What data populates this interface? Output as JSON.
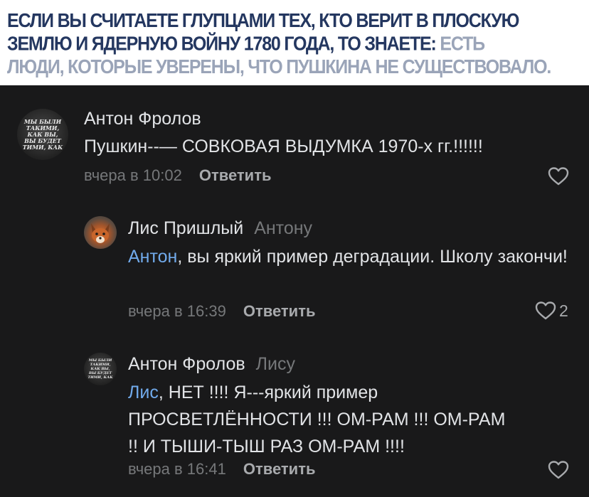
{
  "header": {
    "line1": "ЕСЛИ ВЫ СЧИТАЕТЕ ГЛУПЦАМИ ТЕХ, КТО ВЕРИТ В ПЛОСКУЮ",
    "line2_dark": "ЗЕМЛЮ И ЯДЕРНУЮ ВОЙНУ 1780 ГОДА, ТО ЗНАЕТЕ: ",
    "line2_muted": "ЕСТЬ",
    "line3": "ЛЮДИ, КОТОРЫЕ УВЕРЕНЫ, ЧТО ПУШКИНА НЕ СУЩЕСТВОВАЛО."
  },
  "avatar_caption": "МЫ БЫЛИ ТАКИМИ, КАК ВЫ, ВЫ БУДЕТ ТИМИ, КАК",
  "comments": [
    {
      "author": "Антон Фролов",
      "text": "Пушкин--— СОВКОВАЯ ВЫДУМКА 1970-х гг.!!!!!!",
      "time": "вчера в 10:02",
      "reply_label": "Ответить",
      "likes": ""
    },
    {
      "author": "Лис Пришлый",
      "reply_to": "Антону",
      "mention": "Антон",
      "text": ", вы яркий пример деградации. Школу закончи!",
      "time": "вчера в 16:39",
      "reply_label": "Ответить",
      "likes": "2"
    },
    {
      "author": "Антон Фролов",
      "reply_to": "Лису",
      "mention": "Лис",
      "text": ", НЕТ !!!! Я---яркий пример ПРОСВЕТЛЁННОСТИ !!! ОМ-РАМ !!! ОМ-РАМ !! И ТЫШИ-ТЫШ РАЗ ОМ-РАМ !!!!",
      "time": "вчера в 16:41",
      "reply_label": "Ответить",
      "likes": ""
    }
  ],
  "colors": {
    "background": "#19191a",
    "header_text": "#243760",
    "header_muted": "#9aa4b8",
    "mention": "#71aaeb",
    "secondary_text": "#76787a"
  },
  "icons": [
    "heart-icon"
  ]
}
